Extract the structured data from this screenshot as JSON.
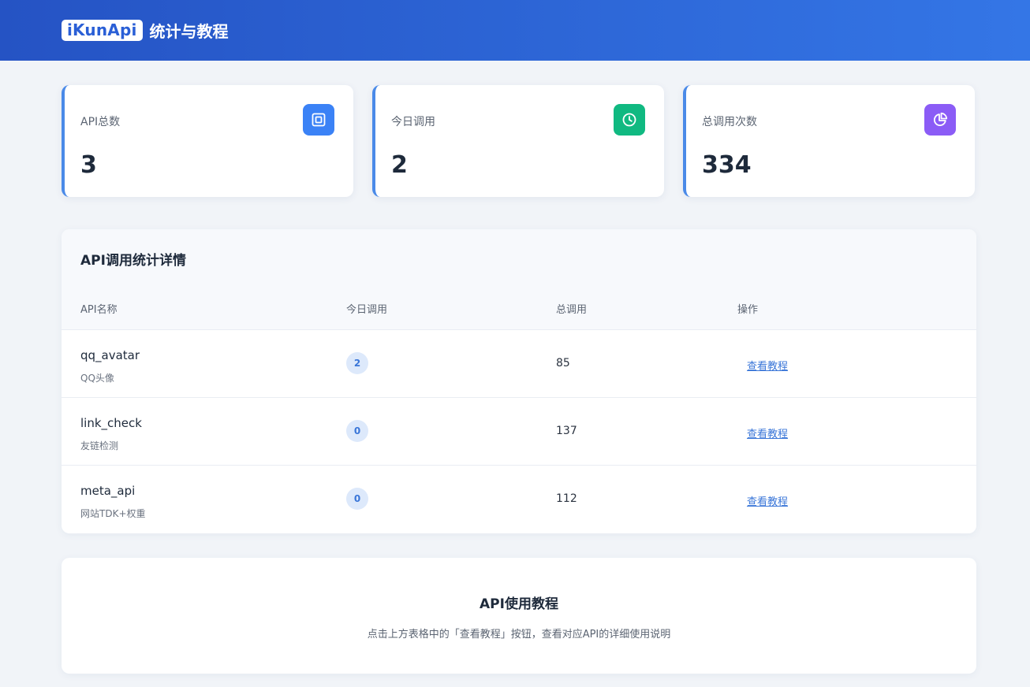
{
  "header": {
    "logo": "iKunApi",
    "title": "统计与教程"
  },
  "stats": [
    {
      "label": "API总数",
      "value": "3",
      "icon": "api-box-icon",
      "color": "#3b82f6"
    },
    {
      "label": "今日调用",
      "value": "2",
      "icon": "clock-icon",
      "color": "#10b981"
    },
    {
      "label": "总调用次数",
      "value": "334",
      "icon": "pie-chart-icon",
      "color": "#8b5cf6"
    }
  ],
  "details": {
    "title": "API调用统计详情",
    "columns": [
      "API名称",
      "今日调用",
      "总调用",
      "操作"
    ],
    "rows": [
      {
        "name": "qq_avatar",
        "desc": "QQ头像",
        "today": "2",
        "total": "85",
        "action": "查看教程"
      },
      {
        "name": "link_check",
        "desc": "友链检测",
        "today": "0",
        "total": "137",
        "action": "查看教程"
      },
      {
        "name": "meta_api",
        "desc": "网站TDK+权重",
        "today": "0",
        "total": "112",
        "action": "查看教程"
      }
    ]
  },
  "tutorial": {
    "title": "API使用教程",
    "description": "点击上方表格中的「查看教程」按钮，查看对应API的详细使用说明"
  }
}
